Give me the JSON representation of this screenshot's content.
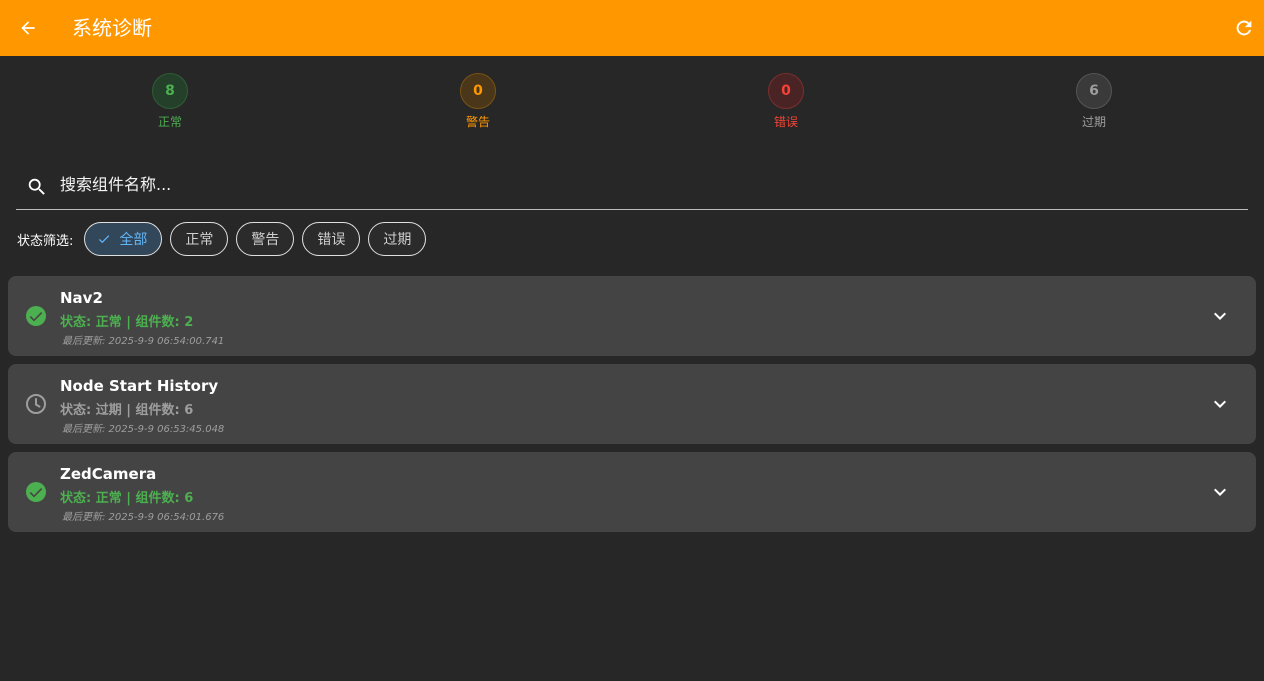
{
  "appbar": {
    "title": "系统诊断"
  },
  "stats": {
    "ok": {
      "count": "8",
      "label": "正常"
    },
    "warn": {
      "count": "0",
      "label": "警告"
    },
    "error": {
      "count": "0",
      "label": "错误"
    },
    "stale": {
      "count": "6",
      "label": "过期"
    }
  },
  "search": {
    "placeholder": "搜索组件名称..."
  },
  "filters": {
    "label": "状态筛选:",
    "chips": [
      "全部",
      "正常",
      "警告",
      "错误",
      "过期"
    ],
    "selected": "全部"
  },
  "items": [
    {
      "name": "Nav2",
      "status": "状态: 正常 | 组件数: 2",
      "updated": "最后更新: 2025-9-9 06:54:00.741",
      "icon": "check-circle-icon"
    },
    {
      "name": "Node Start History",
      "status": "状态: 过期 | 组件数: 6",
      "updated": "最后更新: 2025-9-9 06:53:45.048",
      "icon": "clock-icon"
    },
    {
      "name": "ZedCamera",
      "status": "状态: 正常 | 组件数: 6",
      "updated": "最后更新: 2025-9-9 06:54:01.676",
      "icon": "check-circle-icon"
    }
  ],
  "colors": {
    "accent": "#FF9800",
    "ok": "#4CAF50",
    "warn": "#FF9800",
    "error": "#F44336",
    "stale": "#9E9E9E",
    "selected": "#64B5F6"
  }
}
